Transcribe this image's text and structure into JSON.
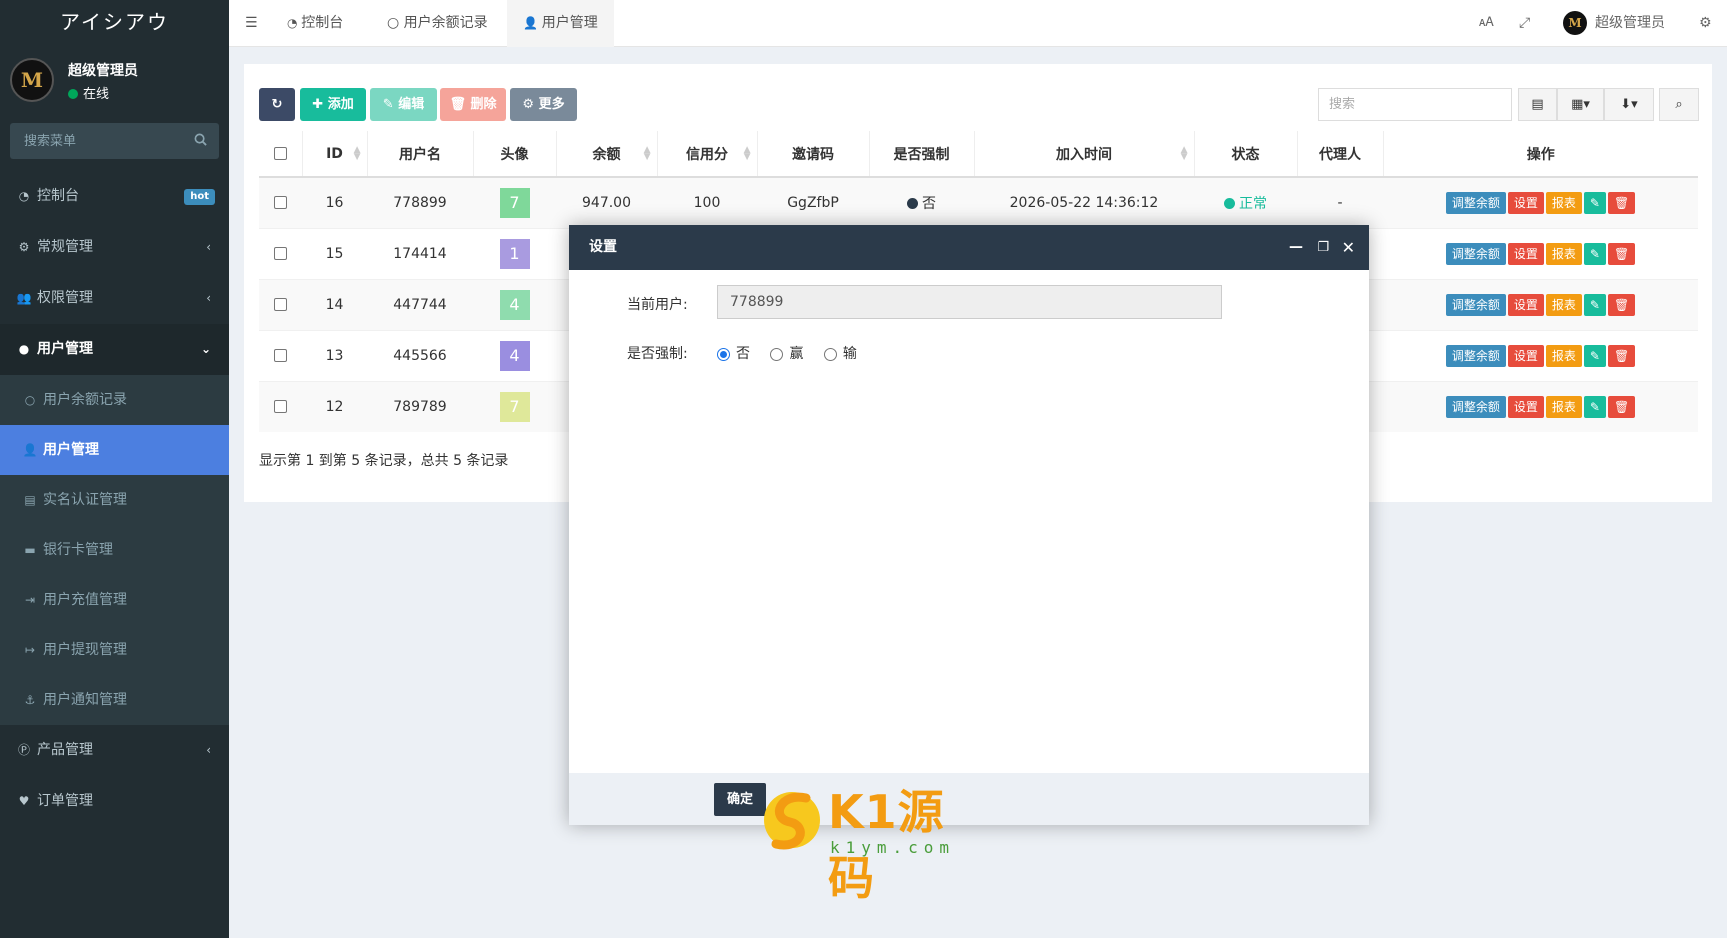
{
  "app": {
    "logo_text": "アイシアウ"
  },
  "user": {
    "name": "超级管理员",
    "status": "在线",
    "avatar_letter": "M"
  },
  "sidebar": {
    "search_placeholder": "搜索菜单",
    "items": [
      {
        "label": "控制台",
        "badge": "hot"
      },
      {
        "label": "常规管理"
      },
      {
        "label": "权限管理"
      },
      {
        "label": "用户管理"
      },
      {
        "label": "用户余额记录"
      },
      {
        "label": "用户管理"
      },
      {
        "label": "实名认证管理"
      },
      {
        "label": "银行卡管理"
      },
      {
        "label": "用户充值管理"
      },
      {
        "label": "用户提现管理"
      },
      {
        "label": "用户通知管理"
      },
      {
        "label": "产品管理"
      },
      {
        "label": "订单管理"
      }
    ]
  },
  "topbar": {
    "tabs": [
      {
        "label": "控制台"
      },
      {
        "label": "用户余额记录"
      },
      {
        "label": "用户管理"
      }
    ],
    "admin_name": "超级管理员"
  },
  "toolbar": {
    "add": "添加",
    "edit": "编辑",
    "delete": "删除",
    "more": "更多",
    "search_placeholder": "搜索"
  },
  "table": {
    "headers": [
      "ID",
      "用户名",
      "头像",
      "余额",
      "信用分",
      "邀请码",
      "是否强制",
      "加入时间",
      "状态",
      "代理人",
      "操作"
    ],
    "rows": [
      {
        "id": "16",
        "username": "778899",
        "avatar": "7",
        "avatar_color": "#7fd89a",
        "balance": "947.00",
        "credit": "100",
        "invite": "GgZfbP",
        "forced": "否",
        "joined": "2026-05-22 14:36:12",
        "status": "正常",
        "agent": "-"
      },
      {
        "id": "15",
        "username": "174414",
        "avatar": "1",
        "avatar_color": "#a99be0"
      },
      {
        "id": "14",
        "username": "447744",
        "avatar": "4",
        "avatar_color": "#8fdcae"
      },
      {
        "id": "13",
        "username": "445566",
        "avatar": "4",
        "avatar_color": "#9a8ee0"
      },
      {
        "id": "12",
        "username": "789789",
        "avatar": "7",
        "avatar_color": "#dfe89a"
      }
    ],
    "ops": {
      "adjust": "调整余额",
      "settings": "设置",
      "report": "报表"
    },
    "footer": "显示第 1 到第 5 条记录，总共 5 条记录"
  },
  "dialog": {
    "title": "设置",
    "current_user_label": "当前用户:",
    "current_user_value": "778899",
    "forced_label": "是否强制:",
    "options": [
      "否",
      "赢",
      "输"
    ],
    "selected": "否",
    "confirm": "确定"
  },
  "watermark": {
    "text": "K1源码",
    "url": "k1ym.com"
  },
  "colors": {
    "sidebar_bg": "#222d32",
    "active_blue": "#4c7fe0",
    "header_dark": "#2b3a4a",
    "btn_refresh": "#3c4a66",
    "btn_add": "#18bc9c",
    "btn_edit": "#7bd7c2",
    "btn_delete": "#f5a49a",
    "btn_more": "#7a8a9a",
    "op_blue": "#3c8dbc",
    "op_red": "#e74c3c",
    "op_orange": "#f39c12",
    "op_green": "#18bc9c",
    "status_green": "#18bc9c"
  }
}
